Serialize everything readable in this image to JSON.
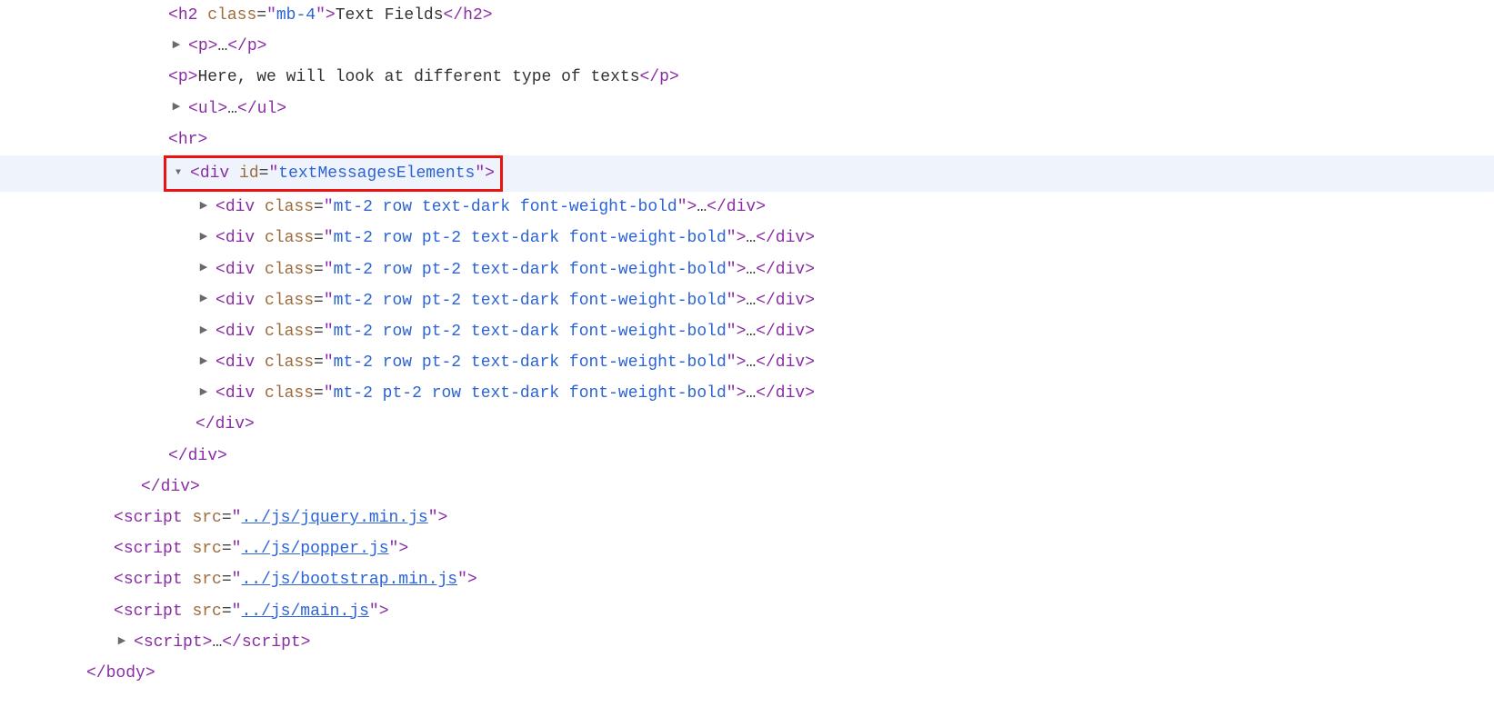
{
  "lines": [
    {
      "indent": 3,
      "triangle": null,
      "highlighted": false,
      "redbox": false,
      "segments": [
        {
          "t": "tagopen",
          "name": "h2",
          "attrs": [
            {
              "n": "class",
              "v": "mb-4"
            }
          ]
        },
        {
          "t": "text",
          "v": "Text Fields"
        },
        {
          "t": "tagclose",
          "name": "h2"
        }
      ]
    },
    {
      "indent": 3,
      "triangle": "right",
      "highlighted": false,
      "redbox": false,
      "segments": [
        {
          "t": "tagopen",
          "name": "p",
          "attrs": []
        },
        {
          "t": "ellipsis"
        },
        {
          "t": "tagclose",
          "name": "p"
        }
      ]
    },
    {
      "indent": 3,
      "triangle": null,
      "highlighted": false,
      "redbox": false,
      "segments": [
        {
          "t": "tagopen",
          "name": "p",
          "attrs": []
        },
        {
          "t": "text",
          "v": "Here, we will look at different type of texts"
        },
        {
          "t": "tagclose",
          "name": "p"
        }
      ]
    },
    {
      "indent": 3,
      "triangle": "right",
      "highlighted": false,
      "redbox": false,
      "segments": [
        {
          "t": "tagopen",
          "name": "ul",
          "attrs": []
        },
        {
          "t": "ellipsis"
        },
        {
          "t": "tagclose",
          "name": "ul"
        }
      ]
    },
    {
      "indent": 3,
      "triangle": null,
      "highlighted": false,
      "redbox": false,
      "segments": [
        {
          "t": "tagopen",
          "name": "hr",
          "attrs": []
        }
      ]
    },
    {
      "indent": 3,
      "triangle": "down",
      "highlighted": true,
      "redbox": true,
      "segments": [
        {
          "t": "tagopen",
          "name": "div",
          "attrs": [
            {
              "n": "id",
              "v": "textMessagesElements"
            }
          ]
        }
      ]
    },
    {
      "indent": 4,
      "triangle": "right",
      "highlighted": false,
      "redbox": false,
      "segments": [
        {
          "t": "tagopen",
          "name": "div",
          "attrs": [
            {
              "n": "class",
              "v": "mt-2 row text-dark font-weight-bold"
            }
          ]
        },
        {
          "t": "ellipsis"
        },
        {
          "t": "tagclose",
          "name": "div"
        }
      ]
    },
    {
      "indent": 4,
      "triangle": "right",
      "highlighted": false,
      "redbox": false,
      "segments": [
        {
          "t": "tagopen",
          "name": "div",
          "attrs": [
            {
              "n": "class",
              "v": "mt-2 row pt-2 text-dark font-weight-bold"
            }
          ]
        },
        {
          "t": "ellipsis"
        },
        {
          "t": "tagclose",
          "name": "div"
        }
      ]
    },
    {
      "indent": 4,
      "triangle": "right",
      "highlighted": false,
      "redbox": false,
      "segments": [
        {
          "t": "tagopen",
          "name": "div",
          "attrs": [
            {
              "n": "class",
              "v": "mt-2 row pt-2 text-dark font-weight-bold"
            }
          ]
        },
        {
          "t": "ellipsis"
        },
        {
          "t": "tagclose",
          "name": "div"
        }
      ]
    },
    {
      "indent": 4,
      "triangle": "right",
      "highlighted": false,
      "redbox": false,
      "segments": [
        {
          "t": "tagopen",
          "name": "div",
          "attrs": [
            {
              "n": "class",
              "v": "mt-2 row pt-2 text-dark font-weight-bold"
            }
          ]
        },
        {
          "t": "ellipsis"
        },
        {
          "t": "tagclose",
          "name": "div"
        }
      ]
    },
    {
      "indent": 4,
      "triangle": "right",
      "highlighted": false,
      "redbox": false,
      "segments": [
        {
          "t": "tagopen",
          "name": "div",
          "attrs": [
            {
              "n": "class",
              "v": "mt-2 row pt-2 text-dark font-weight-bold"
            }
          ]
        },
        {
          "t": "ellipsis"
        },
        {
          "t": "tagclose",
          "name": "div"
        }
      ]
    },
    {
      "indent": 4,
      "triangle": "right",
      "highlighted": false,
      "redbox": false,
      "segments": [
        {
          "t": "tagopen",
          "name": "div",
          "attrs": [
            {
              "n": "class",
              "v": "mt-2 row pt-2 text-dark font-weight-bold"
            }
          ]
        },
        {
          "t": "ellipsis"
        },
        {
          "t": "tagclose",
          "name": "div"
        }
      ]
    },
    {
      "indent": 4,
      "triangle": "right",
      "highlighted": false,
      "redbox": false,
      "segments": [
        {
          "t": "tagopen",
          "name": "div",
          "attrs": [
            {
              "n": "class",
              "v": "mt-2 pt-2 row text-dark font-weight-bold"
            }
          ]
        },
        {
          "t": "ellipsis"
        },
        {
          "t": "tagclose",
          "name": "div"
        }
      ]
    },
    {
      "indent": 4,
      "triangle": null,
      "highlighted": false,
      "redbox": false,
      "segments": [
        {
          "t": "tagclose",
          "name": "div"
        }
      ]
    },
    {
      "indent": 3,
      "triangle": null,
      "highlighted": false,
      "redbox": false,
      "segments": [
        {
          "t": "tagclose",
          "name": "div"
        }
      ]
    },
    {
      "indent": 2,
      "triangle": null,
      "highlighted": false,
      "redbox": false,
      "segments": [
        {
          "t": "tagclose",
          "name": "div"
        }
      ]
    },
    {
      "indent": 1,
      "triangle": null,
      "highlighted": false,
      "redbox": false,
      "segments": [
        {
          "t": "tagopen",
          "name": "script",
          "attrs": [
            {
              "n": "src",
              "v": "../js/jquery.min.js",
              "link": true
            }
          ]
        }
      ]
    },
    {
      "indent": 1,
      "triangle": null,
      "highlighted": false,
      "redbox": false,
      "segments": [
        {
          "t": "tagopen",
          "name": "script",
          "attrs": [
            {
              "n": "src",
              "v": "../js/popper.js",
              "link": true
            }
          ]
        }
      ]
    },
    {
      "indent": 1,
      "triangle": null,
      "highlighted": false,
      "redbox": false,
      "segments": [
        {
          "t": "tagopen",
          "name": "script",
          "attrs": [
            {
              "n": "src",
              "v": "../js/bootstrap.min.js",
              "link": true
            }
          ]
        }
      ]
    },
    {
      "indent": 1,
      "triangle": null,
      "highlighted": false,
      "redbox": false,
      "segments": [
        {
          "t": "tagopen",
          "name": "script",
          "attrs": [
            {
              "n": "src",
              "v": "../js/main.js",
              "link": true
            }
          ]
        }
      ]
    },
    {
      "indent": 1,
      "triangle": "right",
      "highlighted": false,
      "redbox": false,
      "segments": [
        {
          "t": "tagopen",
          "name": "script",
          "attrs": []
        },
        {
          "t": "ellipsis"
        },
        {
          "t": "tagclose",
          "name": "script"
        }
      ]
    },
    {
      "indent": 0,
      "triangle": null,
      "highlighted": false,
      "redbox": false,
      "segments": [
        {
          "t": "tagclose",
          "name": "body"
        }
      ]
    }
  ],
  "glyphs": {
    "right": "▶",
    "down": "▼",
    "ellipsis": "…"
  }
}
